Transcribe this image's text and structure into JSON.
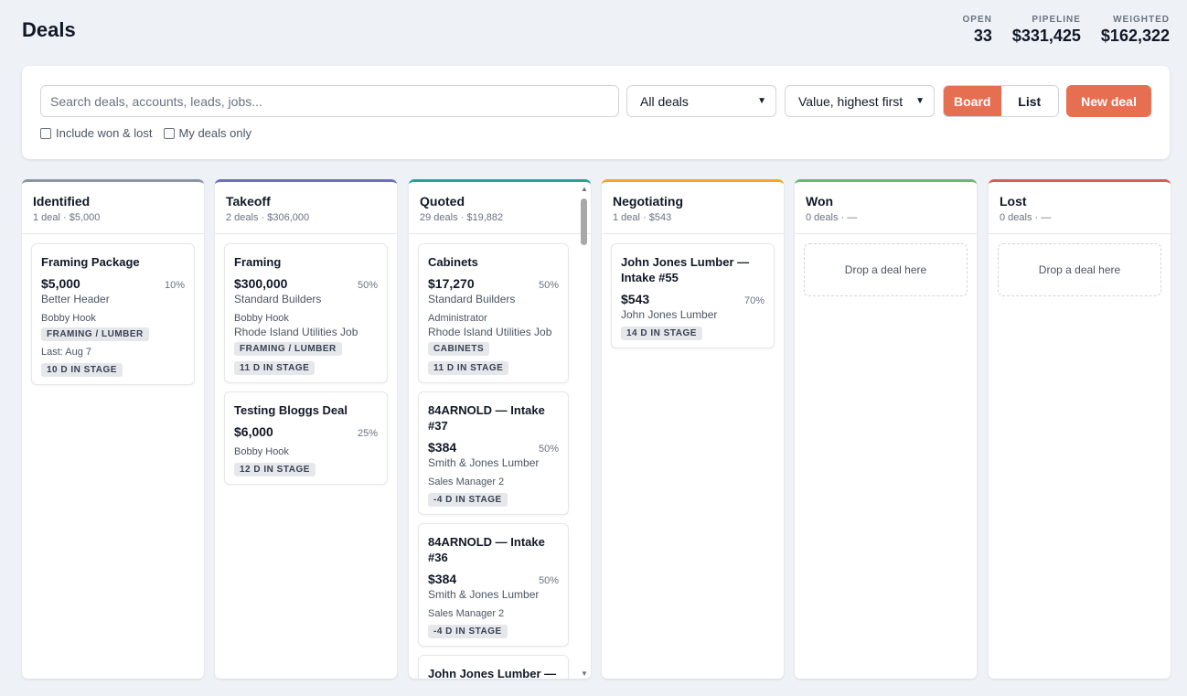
{
  "header": {
    "title": "Deals"
  },
  "stats": [
    {
      "label": "OPEN",
      "value": "33"
    },
    {
      "label": "PIPELINE",
      "value": "$331,425"
    },
    {
      "label": "WEIGHTED",
      "value": "$162,322"
    }
  ],
  "toolbar": {
    "search_placeholder": "Search deals, accounts, leads, jobs...",
    "filter_value": "All deals",
    "sort_value": "Value, highest first",
    "view_board": "Board",
    "view_list": "List",
    "new_deal": "New deal",
    "include_won_lost": "Include won & lost",
    "my_deals_only": "My deals only"
  },
  "icons": {
    "dropdown": "chevron-down-icon",
    "checkbox": "checkbox-icon"
  },
  "colors": {
    "accent": "#e76f51",
    "identified": "#8a96a3",
    "takeoff": "#6b6fbd",
    "quoted": "#2aa198",
    "negotiating": "#f5a623",
    "won": "#66bb6a",
    "lost": "#e05a4f"
  },
  "columns": [
    {
      "title": "Identified",
      "summary": "1 deal · $5,000",
      "cards": [
        {
          "title": "Framing Package",
          "value": "$5,000",
          "pct": "10%",
          "account": "Better Header",
          "owner": "Bobby Hook",
          "tag": "FRAMING / LUMBER",
          "last": "Last: Aug 7",
          "stage": "10 D IN STAGE"
        }
      ]
    },
    {
      "title": "Takeoff",
      "summary": "2 deals · $306,000",
      "cards": [
        {
          "title": "Framing",
          "value": "$300,000",
          "pct": "50%",
          "account": "Standard Builders",
          "owner": "Bobby Hook",
          "job": "Rhode Island Utilities Job",
          "tag": "FRAMING / LUMBER",
          "stage": "11 D IN STAGE"
        },
        {
          "title": "Testing Bloggs Deal",
          "value": "$6,000",
          "pct": "25%",
          "owner": "Bobby Hook",
          "stage": "12 D IN STAGE"
        }
      ]
    },
    {
      "title": "Quoted",
      "summary": "29 deals · $19,882",
      "cards": [
        {
          "title": "Cabinets",
          "value": "$17,270",
          "pct": "50%",
          "account": "Standard Builders",
          "owner": "Administrator",
          "job": "Rhode Island Utilities Job",
          "tag": "CABINETS",
          "stage": "11 D IN STAGE"
        },
        {
          "title": "84ARNOLD — Intake #37",
          "value": "$384",
          "pct": "50%",
          "account": "Smith & Jones Lumber",
          "owner": "Sales Manager 2",
          "stage": "-4 D IN STAGE"
        },
        {
          "title": "84ARNOLD — Intake #36",
          "value": "$384",
          "pct": "50%",
          "account": "Smith & Jones Lumber",
          "owner": "Sales Manager 2",
          "stage": "-4 D IN STAGE"
        },
        {
          "title": "John Jones Lumber —"
        }
      ]
    },
    {
      "title": "Negotiating",
      "summary": "1 deal · $543",
      "cards": [
        {
          "title": "John Jones Lumber — Intake #55",
          "value": "$543",
          "pct": "70%",
          "account": "John Jones Lumber",
          "stage": "14 D IN STAGE"
        }
      ]
    },
    {
      "title": "Won",
      "summary": "0 deals · —",
      "drop_text": "Drop a deal here",
      "cards": []
    },
    {
      "title": "Lost",
      "summary": "0 deals · —",
      "drop_text": "Drop a deal here",
      "cards": []
    }
  ]
}
